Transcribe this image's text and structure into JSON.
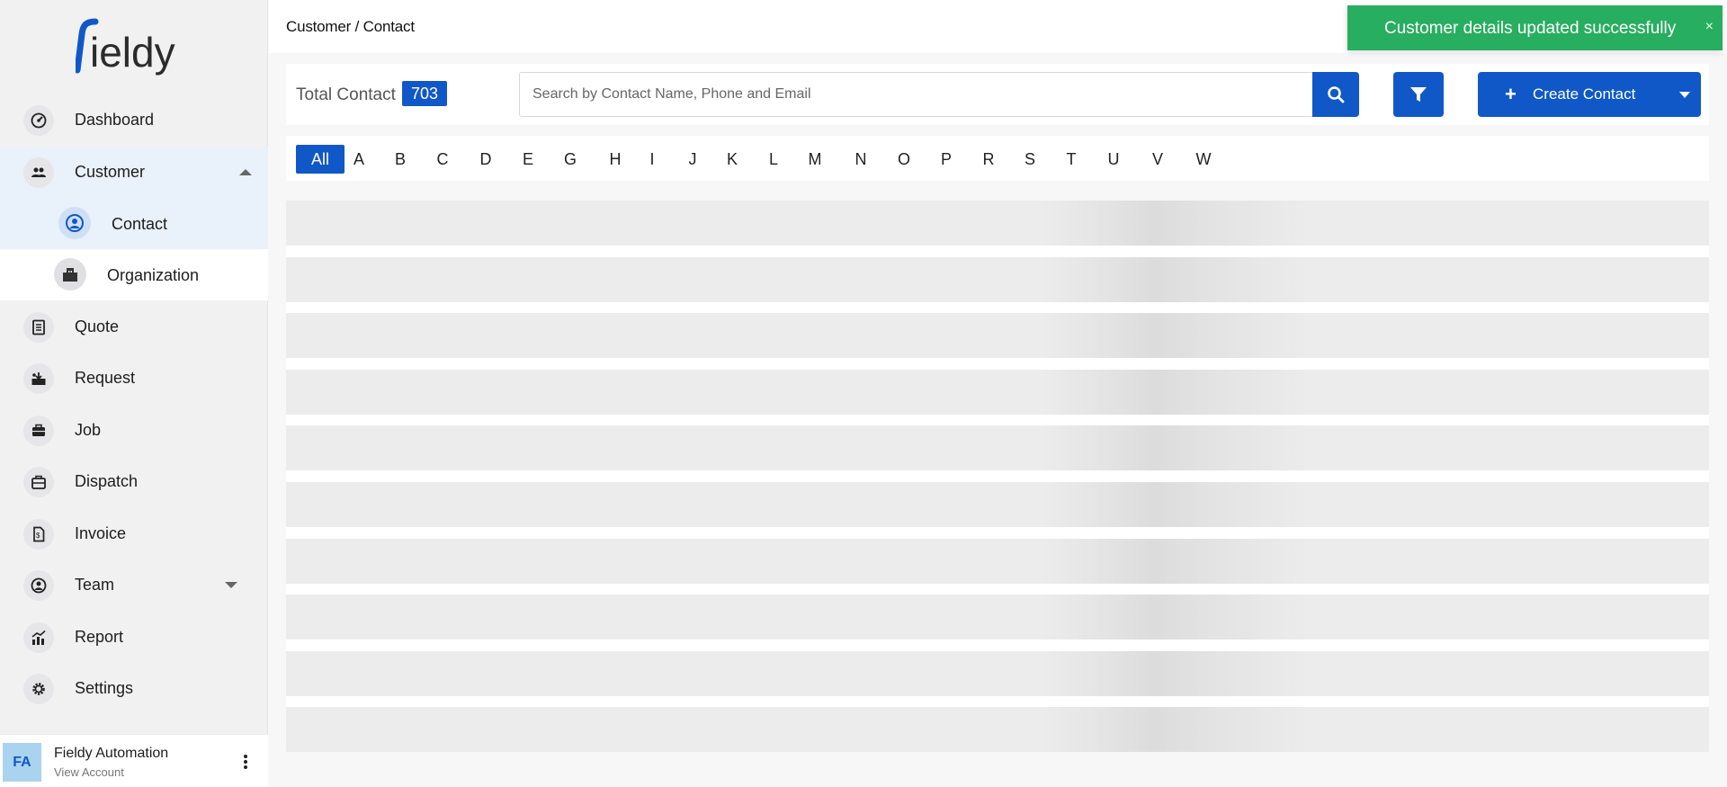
{
  "app": {
    "logo_text": "fieldy"
  },
  "sidebar": {
    "items": [
      {
        "label": "Dashboard",
        "icon": "dashboard-icon"
      },
      {
        "label": "Customer",
        "icon": "customers-icon",
        "expanded": true
      },
      {
        "label": "Quote",
        "icon": "quote-icon"
      },
      {
        "label": "Request",
        "icon": "request-icon"
      },
      {
        "label": "Job",
        "icon": "job-icon"
      },
      {
        "label": "Dispatch",
        "icon": "dispatch-icon"
      },
      {
        "label": "Invoice",
        "icon": "invoice-icon"
      },
      {
        "label": "Team",
        "icon": "team-icon",
        "expanded": false
      },
      {
        "label": "Report",
        "icon": "report-icon"
      },
      {
        "label": "Settings",
        "icon": "settings-icon"
      }
    ],
    "customer_sub": [
      {
        "label": "Contact",
        "icon": "contact-icon",
        "active": true
      },
      {
        "label": "Organization",
        "icon": "organization-icon",
        "active": false
      }
    ],
    "account": {
      "initials": "FA",
      "name": "Fieldy Automation",
      "subtitle": "View Account"
    }
  },
  "header": {
    "breadcrumb": "Customer / Contact"
  },
  "toast": {
    "message": "Customer details updated successfully",
    "close": "×",
    "color": "#27ae60"
  },
  "toolbar": {
    "total_label": "Total Contact",
    "total_count": "703",
    "search_placeholder": "Search by Contact Name, Phone and Email",
    "create_label": "Create Contact",
    "create_plus": "+"
  },
  "alphabet": [
    "All",
    "A",
    "B",
    "C",
    "D",
    "E",
    "G",
    "H",
    "I",
    "J",
    "K",
    "L",
    "M",
    "N",
    "O",
    "P",
    "R",
    "S",
    "T",
    "U",
    "V",
    "W"
  ],
  "alphabet_selected": "All",
  "colors": {
    "primary": "#1058c7",
    "success": "#27ae60"
  }
}
